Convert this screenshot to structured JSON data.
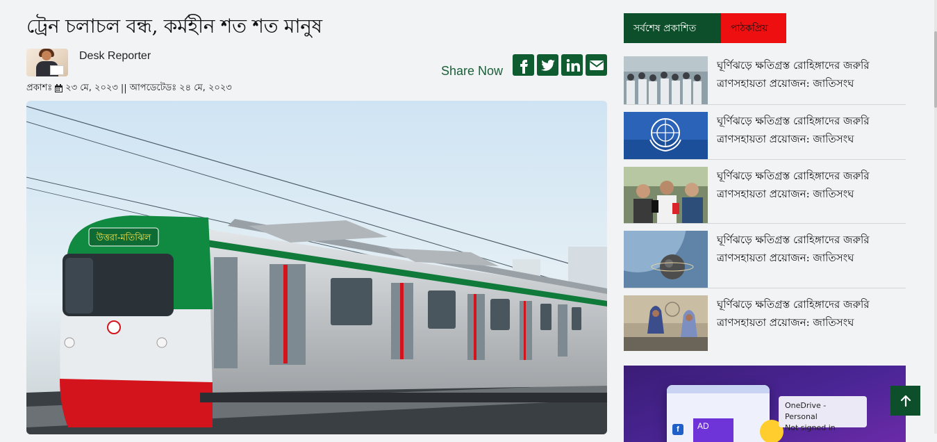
{
  "article": {
    "headline": "ট্রেন চলাচল বন্ধ, কর্মহীন শত শত মানুষ",
    "author": "Desk Reporter",
    "share_label": "Share Now",
    "published_label": "প্রকাশঃ",
    "published_date": "২৩ মে, ২০২৩",
    "separator": "||",
    "updated_label": "আপডেটেডঃ",
    "updated_date": "২৪ মে, ২০২৩",
    "hero_caption_sign": "উত্তরা-মতিঝিল"
  },
  "share_icons": [
    "facebook-icon",
    "twitter-icon",
    "linkedin-icon",
    "email-icon"
  ],
  "sidebar": {
    "tabs": [
      {
        "label": "সর্বশেষ প্রকাশিত",
        "active": true
      },
      {
        "label": "পাঠকপ্রিয়",
        "active": false
      }
    ],
    "news": [
      {
        "title": "ঘূর্ণিঝড়ে ক্ষতিগ্রস্ত রোহিঙ্গাদের জরুরি ত্রাণসহায়তা প্রয়োজন: জাতিসংঘ"
      },
      {
        "title": "ঘূর্ণিঝড়ে ক্ষতিগ্রস্ত রোহিঙ্গাদের জরুরি ত্রাণসহায়তা প্রয়োজন: জাতিসংঘ"
      },
      {
        "title": "ঘূর্ণিঝড়ে ক্ষতিগ্রস্ত রোহিঙ্গাদের জরুরি ত্রাণসহায়তা প্রয়োজন: জাতিসংঘ"
      },
      {
        "title": "ঘূর্ণিঝড়ে ক্ষতিগ্রস্ত রোহিঙ্গাদের জরুরি ত্রাণসহায়তা প্রয়োজন: জাতিসংঘ"
      },
      {
        "title": "ঘূর্ণিঝড়ে ক্ষতিগ্রস্ত রোহিঙ্গাদের জরুরি ত্রাণসহায়তা প্রয়োজন: জাতিসংঘ"
      }
    ]
  },
  "ad": {
    "badge": "AD",
    "fb_letter": "f"
  },
  "tooltip": {
    "line1": "OneDrive - Personal",
    "line2": "Not signed in"
  },
  "colors": {
    "brand_green": "#0d4f2b",
    "accent_red": "#ee1010"
  }
}
